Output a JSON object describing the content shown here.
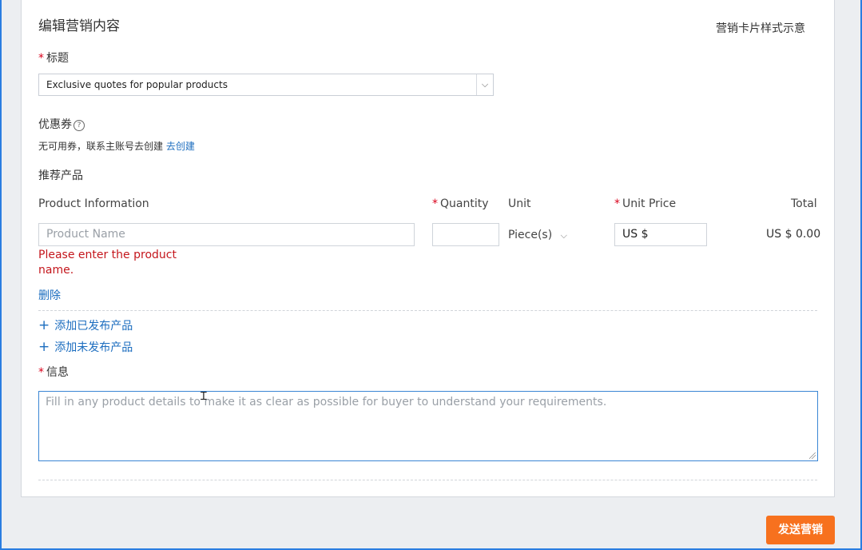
{
  "section": {
    "title": "编辑营销内容",
    "preview_link": "营销卡片样式示意"
  },
  "title_field": {
    "required_mark": "*",
    "label": "标题",
    "selected_value": "Exclusive quotes for popular products",
    "arrow": "⌵"
  },
  "coupon": {
    "label": "优惠券",
    "help_symbol": "?",
    "message": "无可用券，联系主账号去创建",
    "create_link": "去创建"
  },
  "products": {
    "label": "推荐产品",
    "headers": {
      "info": "Product Information",
      "quantity_required": "*",
      "quantity": "Quantity",
      "unit": "Unit",
      "price_required": "*",
      "unit_price": "Unit Price",
      "total": "Total"
    },
    "row": {
      "name_placeholder": "Product Name",
      "quantity_value": "",
      "unit_value": "Piece(s)",
      "unit_arrow": "⌵",
      "price_prefix": "US $",
      "total": "US $ 0.00",
      "error": "Please enter the product name.",
      "delete_link": "删除"
    },
    "add_published": "添加已发布产品",
    "add_unpublished": "添加未发布产品",
    "plus_symbol": "+"
  },
  "message": {
    "required_mark": "*",
    "label": "信息",
    "placeholder": "Fill in any product details to make it as clear as possible for buyer to understand your requirements."
  },
  "actions": {
    "send_label": "发送营销"
  },
  "colors": {
    "link": "#1c6dbf",
    "error": "#c4161c",
    "primary_button": "#f7711e",
    "focus_border": "#3a86d4"
  }
}
